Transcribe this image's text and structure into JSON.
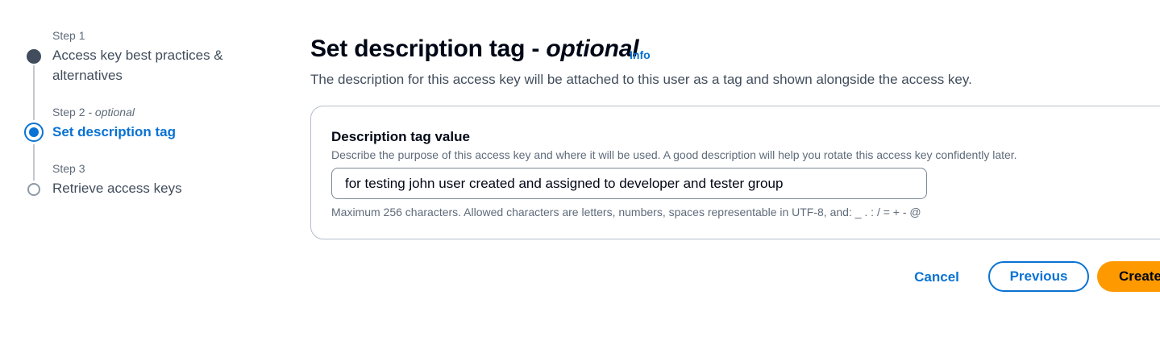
{
  "wizard": {
    "steps": [
      {
        "caption": "Step 1",
        "optional_label": "",
        "title_line1": "Access key best practices &",
        "title_line2": "alternatives",
        "state": "completed"
      },
      {
        "caption": "Step 2",
        "optional_label": "- optional",
        "title_line1": "Set description tag",
        "title_line2": "",
        "state": "current"
      },
      {
        "caption": "Step 3",
        "optional_label": "",
        "title_line1": "Retrieve access keys",
        "title_line2": "",
        "state": "pending"
      }
    ]
  },
  "header": {
    "title": "Set description tag -",
    "title_suffix": "optional",
    "info_link": "Info",
    "description": "The description for this access key will be attached to this user as a tag and shown alongside the access key."
  },
  "form": {
    "label": "Description tag value",
    "description": "Describe the purpose of this access key and where it will be used. A good description will help you rotate this access key confidently later.",
    "value": "for testing john user created and assigned to developer and tester group",
    "constraint": "Maximum 256 characters. Allowed characters are letters, numbers, spaces representable in UTF-8, and: _ . : / = + - @"
  },
  "actions": {
    "cancel": "Cancel",
    "previous": "Previous",
    "create": "Create"
  },
  "colors": {
    "link_blue": "#0972d3",
    "primary_orange": "#ff9900",
    "completed_step": "#414d5c",
    "border": "#b6bec9"
  }
}
